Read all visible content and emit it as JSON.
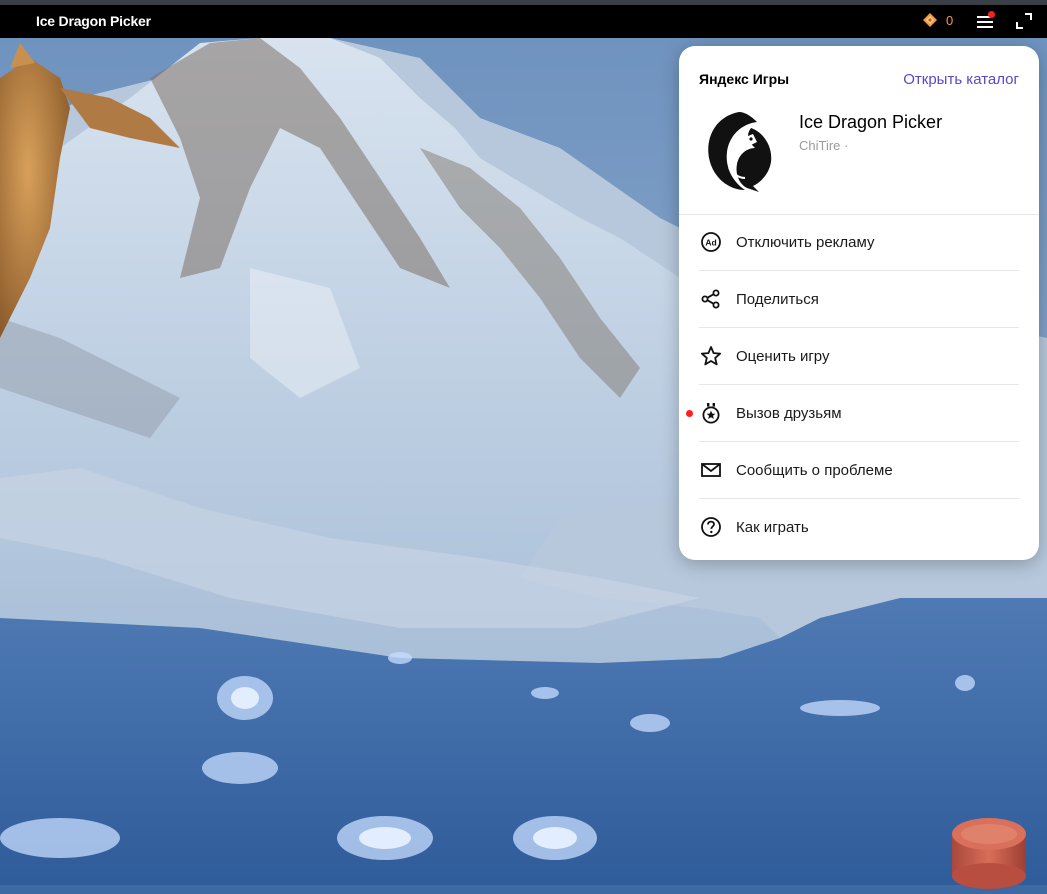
{
  "topbar": {
    "game_title": "Ice Dragon Picker",
    "coin_count": "0",
    "coin_icon": "yan-coin-icon",
    "menu_icon": "menu-icon",
    "fullscreen_icon": "fullscreen-icon",
    "accent": "#f2994a"
  },
  "popup": {
    "brand": "Яндекс Игры",
    "catalog_link": "Открыть каталог",
    "game_name": "Ice Dragon Picker",
    "developer": "ChiTire ·",
    "link_color": "#5b47c9",
    "items": [
      {
        "label": "Отключить рекламу",
        "icon": "ad-off-icon"
      },
      {
        "label": "Поделиться",
        "icon": "share-icon"
      },
      {
        "label": "Оценить игру",
        "icon": "star-icon"
      },
      {
        "label": "Вызов друзьям",
        "icon": "challenge-medal-icon",
        "notification": true
      },
      {
        "label": "Сообщить о проблеме",
        "icon": "mail-icon"
      },
      {
        "label": "Как играть",
        "icon": "help-icon"
      }
    ]
  }
}
